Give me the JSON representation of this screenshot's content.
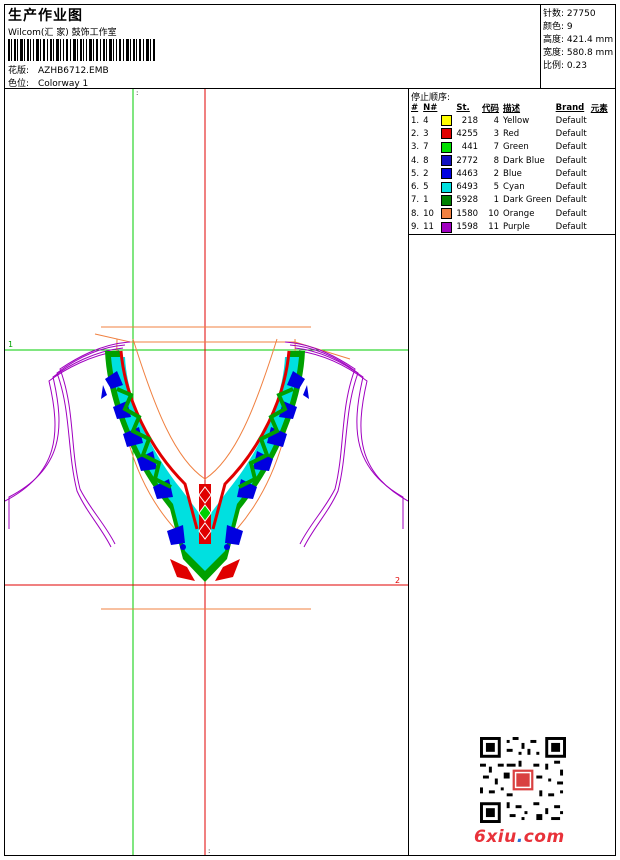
{
  "header": {
    "title": "生产作业图",
    "subtitle": "Wilcom(汇 家) 鼓饰工作室",
    "design_label": "花版:",
    "design_value": "AZHB6712.EMB",
    "colorway_label": "色位:",
    "colorway_value": "Colorway 1"
  },
  "stats": [
    {
      "label": "针数:",
      "value": "27750"
    },
    {
      "label": "颜色:",
      "value": "9"
    },
    {
      "label": "高度:",
      "value": "421.4 mm"
    },
    {
      "label": "宽度:",
      "value": "580.8 mm"
    },
    {
      "label": "比例:",
      "value": "0.23"
    }
  ],
  "stop_sequence": {
    "title": "停止顺序:",
    "columns": [
      "#",
      "N#",
      "St.",
      "代码",
      "描述",
      "Brand",
      "元素"
    ],
    "rows": [
      {
        "index": "1.",
        "needle": "4",
        "color": "#ffff00",
        "stitches": "218",
        "code": "4",
        "description": "Yellow",
        "brand": "Default"
      },
      {
        "index": "2.",
        "needle": "3",
        "color": "#e00000",
        "stitches": "4255",
        "code": "3",
        "description": "Red",
        "brand": "Default"
      },
      {
        "index": "3.",
        "needle": "7",
        "color": "#00e000",
        "stitches": "441",
        "code": "7",
        "description": "Green",
        "brand": "Default"
      },
      {
        "index": "4.",
        "needle": "8",
        "color": "#1010c0",
        "stitches": "2772",
        "code": "8",
        "description": "Dark Blue",
        "brand": "Default"
      },
      {
        "index": "5.",
        "needle": "2",
        "color": "#0000e0",
        "stitches": "4463",
        "code": "2",
        "description": "Blue",
        "brand": "Default"
      },
      {
        "index": "6.",
        "needle": "5",
        "color": "#00e0e0",
        "stitches": "6493",
        "code": "5",
        "description": "Cyan",
        "brand": "Default"
      },
      {
        "index": "7.",
        "needle": "1",
        "color": "#008000",
        "stitches": "5928",
        "code": "1",
        "description": "Dark Green",
        "brand": "Default"
      },
      {
        "index": "8.",
        "needle": "10",
        "color": "#f08040",
        "stitches": "1580",
        "code": "10",
        "description": "Orange",
        "brand": "Default"
      },
      {
        "index": "9.",
        "needle": "11",
        "color": "#a000c0",
        "stitches": "1598",
        "code": "11",
        "description": "Purple",
        "brand": "Default"
      }
    ]
  },
  "canvas": {
    "guide_label_1": "1",
    "guide_label_2": "2"
  },
  "watermark": {
    "text_a": "6xiu",
    "text_dot": ".",
    "text_b": "com"
  }
}
